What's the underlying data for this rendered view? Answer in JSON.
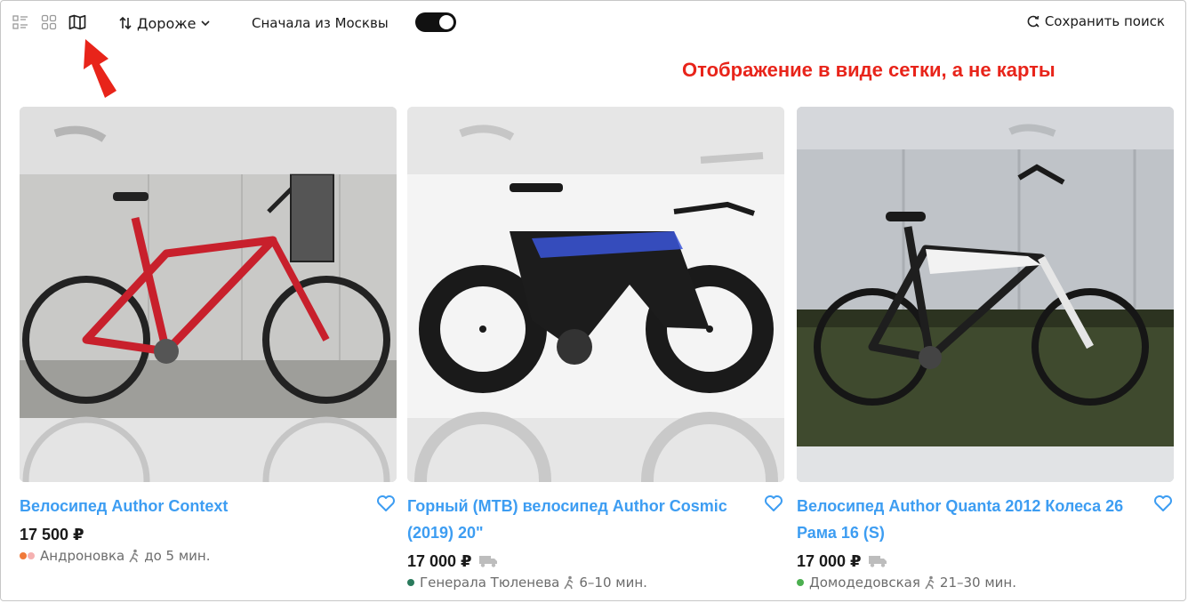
{
  "toolbar": {
    "view_modes": [
      "list-view",
      "grid-view",
      "map-view"
    ],
    "sort_label": "Дороже",
    "moscow_first_label": "Сначала из Москвы",
    "moscow_first_enabled": true,
    "save_search_label": "Сохранить поиск"
  },
  "annotation": {
    "text": "Отображение в виде сетки, а не карты",
    "color": "#e8241a"
  },
  "colors": {
    "link": "#3d9df2",
    "price": "#1a1a1a",
    "meta": "#6c6c6c"
  },
  "listings": [
    {
      "title": "Велосипед Author Context",
      "price": "17 500 ₽",
      "delivery": false,
      "metro_station": "Андроновка",
      "metro_colors": [
        "#f07a3a",
        "#f5b1b1"
      ],
      "walk_time": "до 5 мин.",
      "image": "red-mountain-bike"
    },
    {
      "title": "Горный (МТВ) велосипед Author Cosmic (2019) 20\"",
      "price": "17 000 ₽",
      "delivery": true,
      "metro_station": "Генерала Тюленева",
      "metro_colors": [
        "#2a7a5c"
      ],
      "walk_time": "6–10 мин.",
      "image": "black-triathlon-bike"
    },
    {
      "title": "Велосипед Author Quanta 2012 Колеса 26 Рама 16 (S)",
      "price": "17 000 ₽",
      "delivery": true,
      "metro_station": "Домодедовская",
      "metro_colors": [
        "#4caf50"
      ],
      "walk_time": "21–30 мин.",
      "image": "white-black-bike"
    }
  ]
}
